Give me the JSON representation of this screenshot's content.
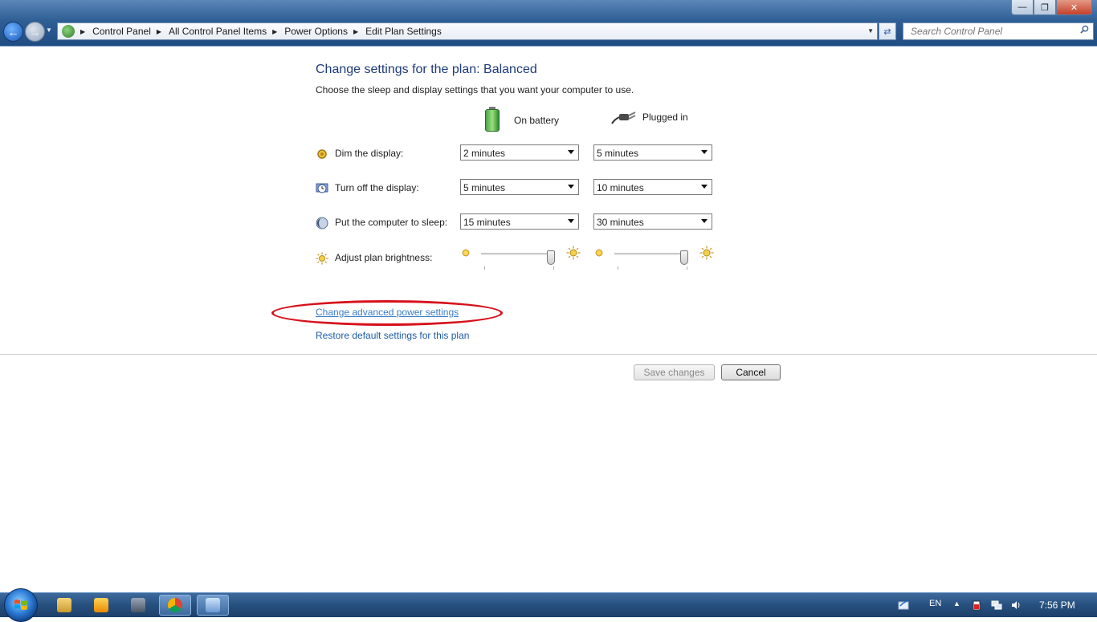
{
  "window": {
    "address": {
      "breadcrumbs": [
        "Control Panel",
        "All Control Panel Items",
        "Power Options",
        "Edit Plan Settings"
      ]
    },
    "search": {
      "placeholder": "Search Control Panel"
    }
  },
  "page": {
    "title": "Change settings for the plan: Balanced",
    "description": "Choose the sleep and display settings that you want your computer to use.",
    "columns": {
      "battery": "On battery",
      "plugged": "Plugged in"
    },
    "rows": [
      {
        "label": "Dim the display:",
        "battery": "2 minutes",
        "plugged": "5 minutes",
        "icon": "dim-icon"
      },
      {
        "label": "Turn off the display:",
        "battery": "5 minutes",
        "plugged": "10 minutes",
        "icon": "monitor-clock-icon"
      },
      {
        "label": "Put the computer to sleep:",
        "battery": "15 minutes",
        "plugged": "30 minutes",
        "icon": "moon-icon"
      }
    ],
    "brightness": {
      "label": "Adjust plan brightness:",
      "battery_level": 1.0,
      "plugged_level": 1.0
    },
    "links": {
      "advanced": "Change advanced power settings",
      "restore": "Restore default settings for this plan"
    },
    "buttons": {
      "save": "Save changes",
      "cancel": "Cancel"
    },
    "annotation": {
      "color": "#d6111b",
      "target": "Change advanced power settings"
    }
  },
  "taskbar": {
    "language": "EN",
    "time": "7:56 PM",
    "apps": [
      "explorer-icon",
      "media-player-icon",
      "app-icon",
      "chrome-icon",
      "control-panel-icon"
    ]
  },
  "colors": {
    "title": "#1e3b7b",
    "link": "#1d5ba5",
    "taskbar": "#27507f"
  }
}
